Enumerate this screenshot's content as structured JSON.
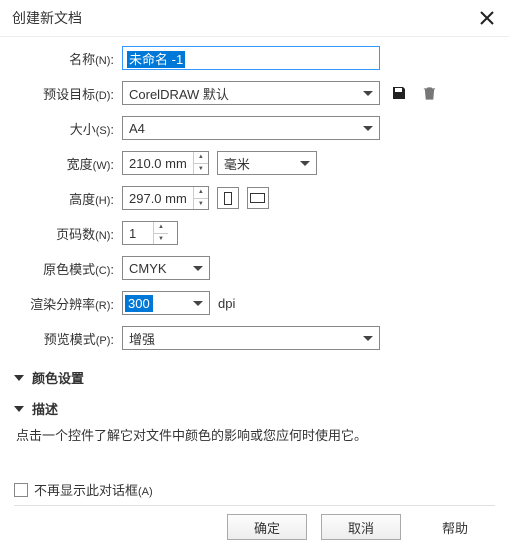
{
  "dialog": {
    "title": "创建新文档"
  },
  "fields": {
    "name": {
      "label": "名称",
      "ak": "(N)",
      "value": "未命名 -1"
    },
    "preset": {
      "label": "预设目标",
      "ak": "(D)",
      "value": "CorelDRAW 默认"
    },
    "size": {
      "label": "大小",
      "ak": "(S)",
      "value": "A4"
    },
    "width": {
      "label": "宽度",
      "ak": "(W)",
      "value": "210.0 mm",
      "unit": "毫米"
    },
    "height": {
      "label": "高度",
      "ak": "(H)",
      "value": "297.0 mm"
    },
    "pages": {
      "label": "页码数",
      "ak": "(N)",
      "value": "1"
    },
    "colormode": {
      "label": "原色模式",
      "ak": "(C)",
      "value": "CMYK"
    },
    "resolution": {
      "label": "渲染分辨率",
      "ak": "(R)",
      "value": "300",
      "suffix": "dpi"
    },
    "preview": {
      "label": "预览模式",
      "ak": "(P)",
      "value": "增强"
    }
  },
  "sections": {
    "color": "颜色设置",
    "desc": "描述"
  },
  "desc_text": "点击一个控件了解它对文件中颜色的影响或您应何时使用它。",
  "footer": {
    "dontshow": "不再显示此对话框",
    "dontshow_ak": "(A)",
    "ok": "确定",
    "cancel": "取消",
    "help": "帮助"
  }
}
